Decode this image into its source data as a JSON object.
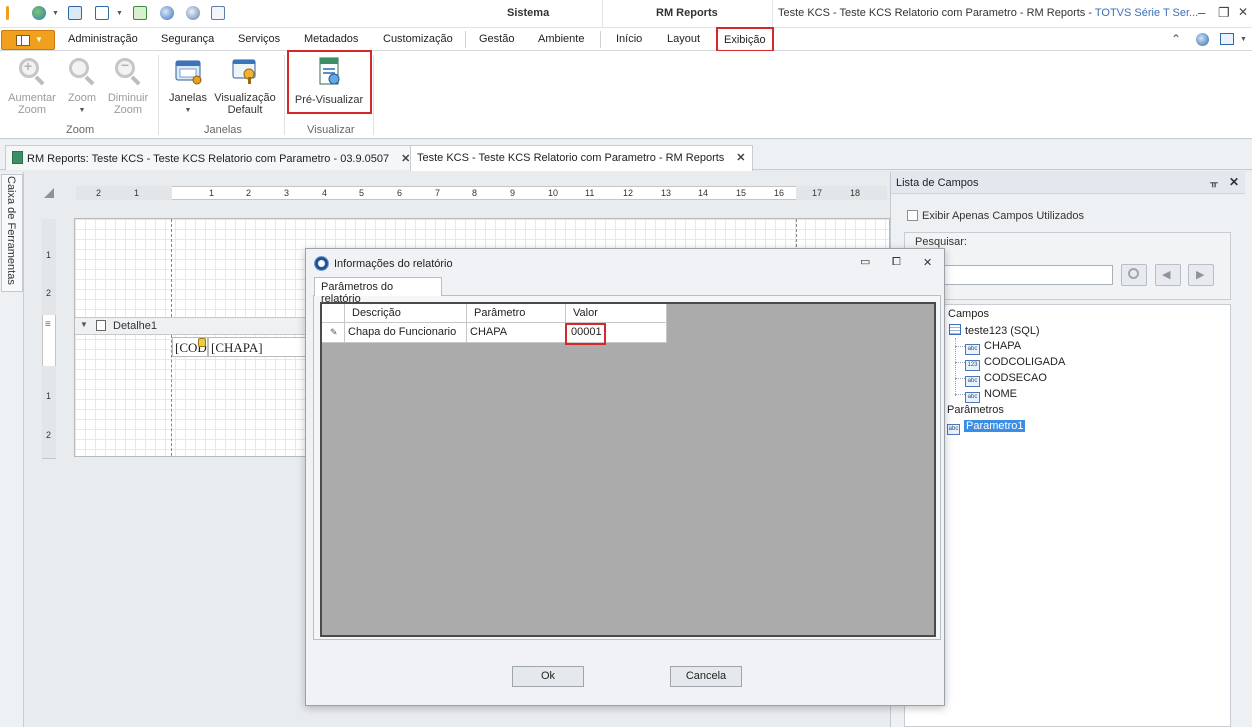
{
  "titlebar": {
    "context_tab_sistema": "Sistema",
    "context_tab_reports": "RM Reports",
    "document_title": "Teste KCS - Teste KCS Relatorio com Parametro - RM Reports - ",
    "brand_title": "TOTVS Série T Ser..."
  },
  "ribbon_tabs": {
    "administracao": "Administração",
    "seguranca": "Segurança",
    "servicos": "Serviços",
    "metadados": "Metadados",
    "customizacao": "Customização",
    "gestao": "Gestão",
    "ambiente": "Ambiente",
    "inicio": "Início",
    "layout": "Layout",
    "exibicao": "Exibição"
  },
  "ribbon": {
    "zoom_in": "Aumentar\nZoom",
    "zoom_in_1": "Aumentar",
    "zoom_in_2": "Zoom",
    "zoom": "Zoom",
    "zoom_out_1": "Diminuir",
    "zoom_out_2": "Zoom",
    "janelas": "Janelas",
    "visualizacao_1": "Visualização",
    "visualizacao_2": "Default",
    "pre_visualizar": "Pré-Visualizar",
    "group_zoom": "Zoom",
    "group_janelas": "Janelas",
    "group_visualizar": "Visualizar"
  },
  "doc_tabs": [
    {
      "label": "RM Reports: Teste KCS - Teste KCS Relatorio com Parametro - 03.9.0507"
    },
    {
      "label": "Teste KCS - Teste KCS Relatorio com Parametro - RM Reports"
    }
  ],
  "toolbox": {
    "label": "Caixa de Ferramentas"
  },
  "designer": {
    "ruler_numbers": [
      "2",
      "1",
      "1",
      "2",
      "3",
      "4",
      "5",
      "6",
      "7",
      "8",
      "9",
      "10",
      "11",
      "12",
      "13",
      "14",
      "15",
      "16",
      "17",
      "18"
    ],
    "vruler_numbers": [
      "1",
      "2",
      "1",
      "2"
    ],
    "band_label": "Detalhe1",
    "field_codcoligada": "[COD",
    "field_chapa": "[CHAPA]"
  },
  "field_panel": {
    "title": "Lista de Campos",
    "show_used_label": "Exibir Apenas Campos Utilizados",
    "search_label": "Pesquisar:",
    "search_value": "",
    "tree": {
      "campos": "Campos",
      "dataset": "teste123 (SQL)",
      "fields": [
        {
          "name": "CHAPA",
          "type": "abc"
        },
        {
          "name": "CODCOLIGADA",
          "type": "123"
        },
        {
          "name": "CODSECAO",
          "type": "abc"
        },
        {
          "name": "NOME",
          "type": "abc"
        }
      ],
      "parametros": "Parâmetros",
      "param1": "Parametro1",
      "param1_type": "abc"
    }
  },
  "dialog": {
    "title": "Informações do relatório",
    "tab": "Parâmetros do relatório",
    "columns": [
      "Descrição",
      "Parâmetro",
      "Valor"
    ],
    "rows": [
      {
        "descricao": "Chapa do Funcionario",
        "parametro": "CHAPA",
        "valor": "00001"
      }
    ],
    "ok": "Ok",
    "cancel": "Cancela"
  },
  "colors": {
    "accent": "#f0a01d",
    "highlight": "#d42929",
    "selection": "#3a8ee6"
  }
}
